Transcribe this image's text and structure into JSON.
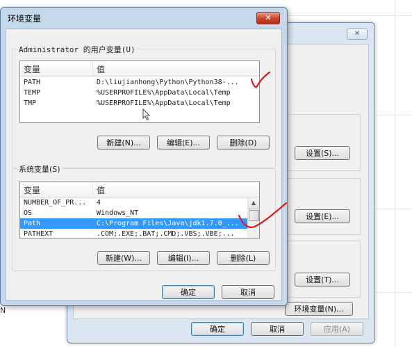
{
  "background": {
    "side_text": "N"
  },
  "system_properties": {
    "close_label": "✕",
    "settings_button_1": "设置(S)...",
    "settings_button_2": "设置(E)...",
    "settings_button_3": "设置(T)...",
    "env_button": "环境变量(N)...",
    "ok_label": "确定",
    "cancel_label": "取消",
    "apply_label": "应用(A)"
  },
  "env_dialog": {
    "title": "环境变量",
    "close_label": "✕",
    "user_group_label": "Administrator 的用户变量(U)",
    "system_group_label": "系统变量(S)",
    "columns": {
      "var": "变量",
      "value": "值"
    },
    "user_vars": [
      {
        "name": "PATH",
        "value": "D:\\liujianhong\\Python\\Python38-..."
      },
      {
        "name": "TEMP",
        "value": "%USERPROFILE%\\AppData\\Local\\Temp"
      },
      {
        "name": "TMP",
        "value": "%USERPROFILE%\\AppData\\Local\\Temp"
      }
    ],
    "system_vars": [
      {
        "name": "NUMBER_OF_PR...",
        "value": "4"
      },
      {
        "name": "OS",
        "value": "Windows_NT"
      },
      {
        "name": "Path",
        "value": "C:\\Program Files\\Java\\jdk1.7.0_..."
      },
      {
        "name": "PATHEXT",
        "value": ".COM;.EXE;.BAT;.CMD;.VBS;.VBE;..."
      }
    ],
    "user_buttons": {
      "new": "新建(N)...",
      "edit": "编辑(E)...",
      "delete": "删除(D)"
    },
    "system_buttons": {
      "new": "新建(W)...",
      "edit": "编辑(I)...",
      "delete": "删除(L)"
    },
    "ok_label": "确定",
    "cancel_label": "取消"
  },
  "colors": {
    "selection": "#3399ff",
    "annotation": "#e0141e",
    "title_bar": "#c6d9ec"
  }
}
